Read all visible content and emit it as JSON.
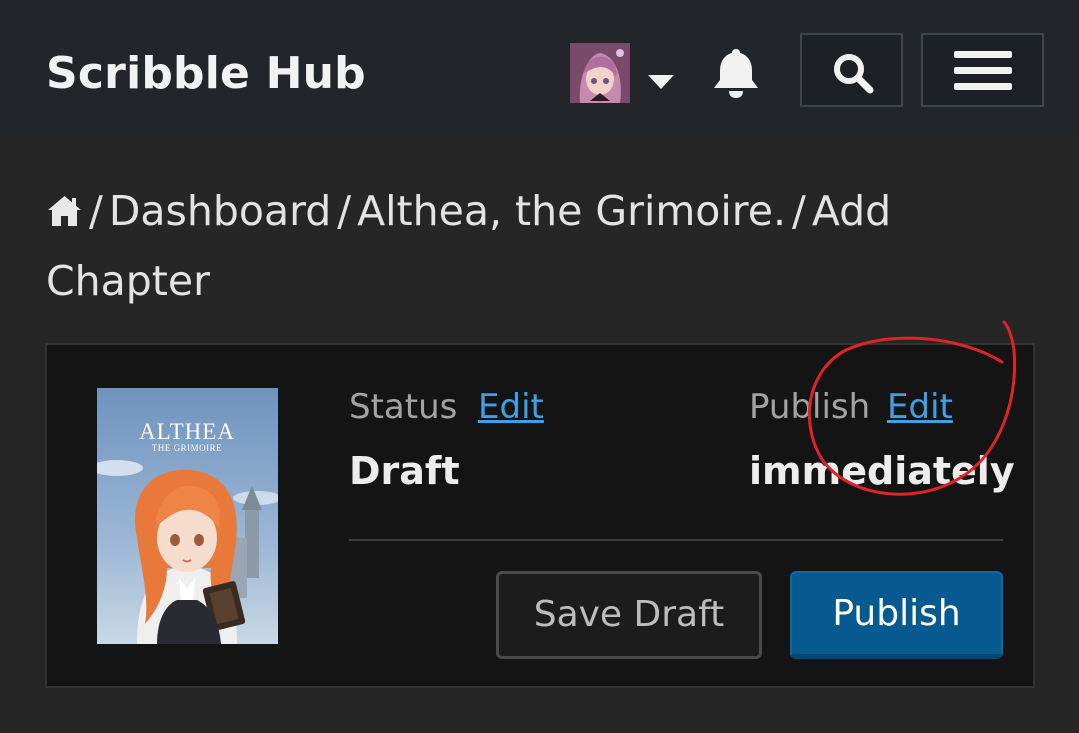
{
  "header": {
    "brand": "Scribble Hub",
    "icons": {
      "avatar": "user-avatar",
      "caret": "caret-down-icon",
      "bell": "bell-icon",
      "search": "search-icon",
      "menu": "hamburger-menu-icon"
    }
  },
  "breadcrumb": {
    "home_icon": "home-icon",
    "separator": "/",
    "items": [
      "Dashboard",
      "Althea, the Grimoire.",
      "Add Chapter"
    ]
  },
  "chapter_card": {
    "cover": {
      "title": "ALTHEA",
      "subtitle": "THE GRIMOIRE"
    },
    "status": {
      "label": "Status",
      "edit_label": "Edit",
      "value": "Draft"
    },
    "publish": {
      "label": "Publish",
      "edit_label": "Edit",
      "value": "immediately"
    },
    "buttons": {
      "save_draft": "Save Draft",
      "publish": "Publish"
    }
  },
  "colors": {
    "header_bg": "#22262a",
    "page_bg": "#262626",
    "card_bg": "#141414",
    "link": "#3ea0e6",
    "primary_button": "#075a8f",
    "annotation_circle": "#e0232a"
  }
}
